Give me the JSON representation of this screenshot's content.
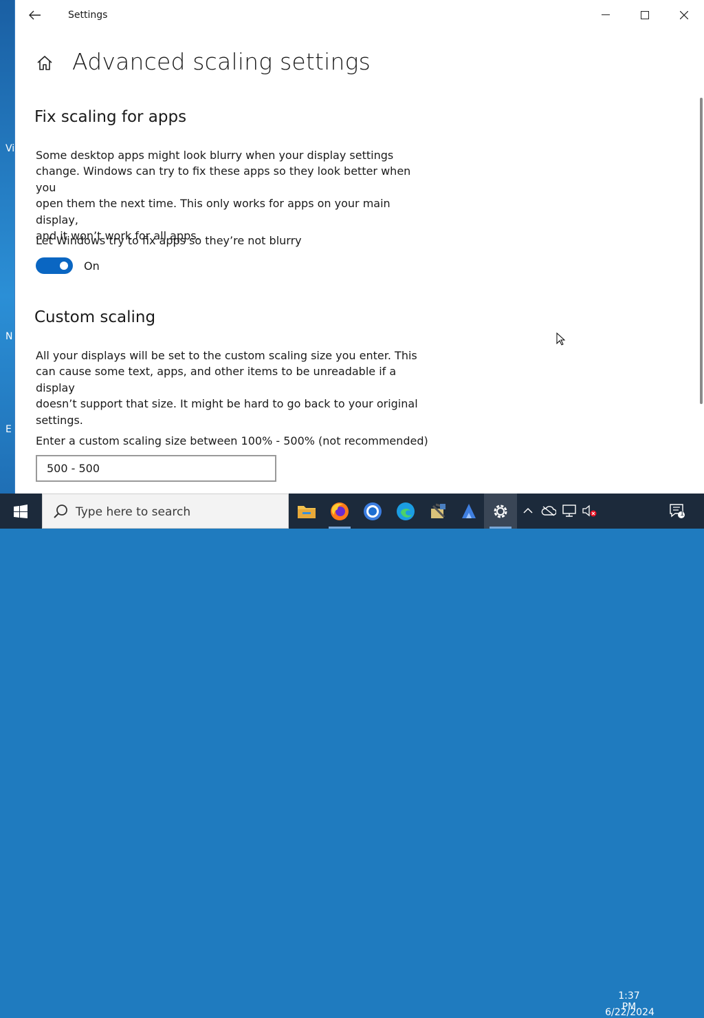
{
  "window": {
    "title": "Settings"
  },
  "page": {
    "title": "Advanced scaling settings"
  },
  "fix_scaling": {
    "heading": "Fix scaling for apps",
    "description_lines": [
      "Some desktop apps might look blurry when your display settings",
      "change. Windows can try to fix these apps so they look better when you",
      "open them the next time. This only works for apps on your main display,",
      "and it won’t work for all apps."
    ],
    "toggle_label": "Let Windows try to fix apps so they’re not blurry",
    "toggle_state": "On",
    "toggle_on": true
  },
  "custom_scaling": {
    "heading": "Custom scaling",
    "description_lines": [
      "All your displays will be set to the custom scaling size you enter. This",
      "can cause some text, apps, and other items to be unreadable if a display",
      "doesn’t support that size. It might be hard to go back to your original",
      "settings."
    ],
    "input_label": "Enter a custom scaling size between 100% - 500% (not recommended)",
    "input_value": "500 - 500"
  },
  "desktop_edge_letters": [
    "Vi",
    "N",
    "E"
  ],
  "taskbar": {
    "search_placeholder": "Type here to search",
    "apps": [
      "file-explorer",
      "firefox",
      "chrome",
      "edge",
      "app-5",
      "app-6",
      "settings"
    ],
    "clock_time": "1:37 PM",
    "clock_date": "6/22/2024",
    "notification_count": "1"
  },
  "colors": {
    "accent": "#0a66c2",
    "taskbar": "#1c2a3b"
  }
}
